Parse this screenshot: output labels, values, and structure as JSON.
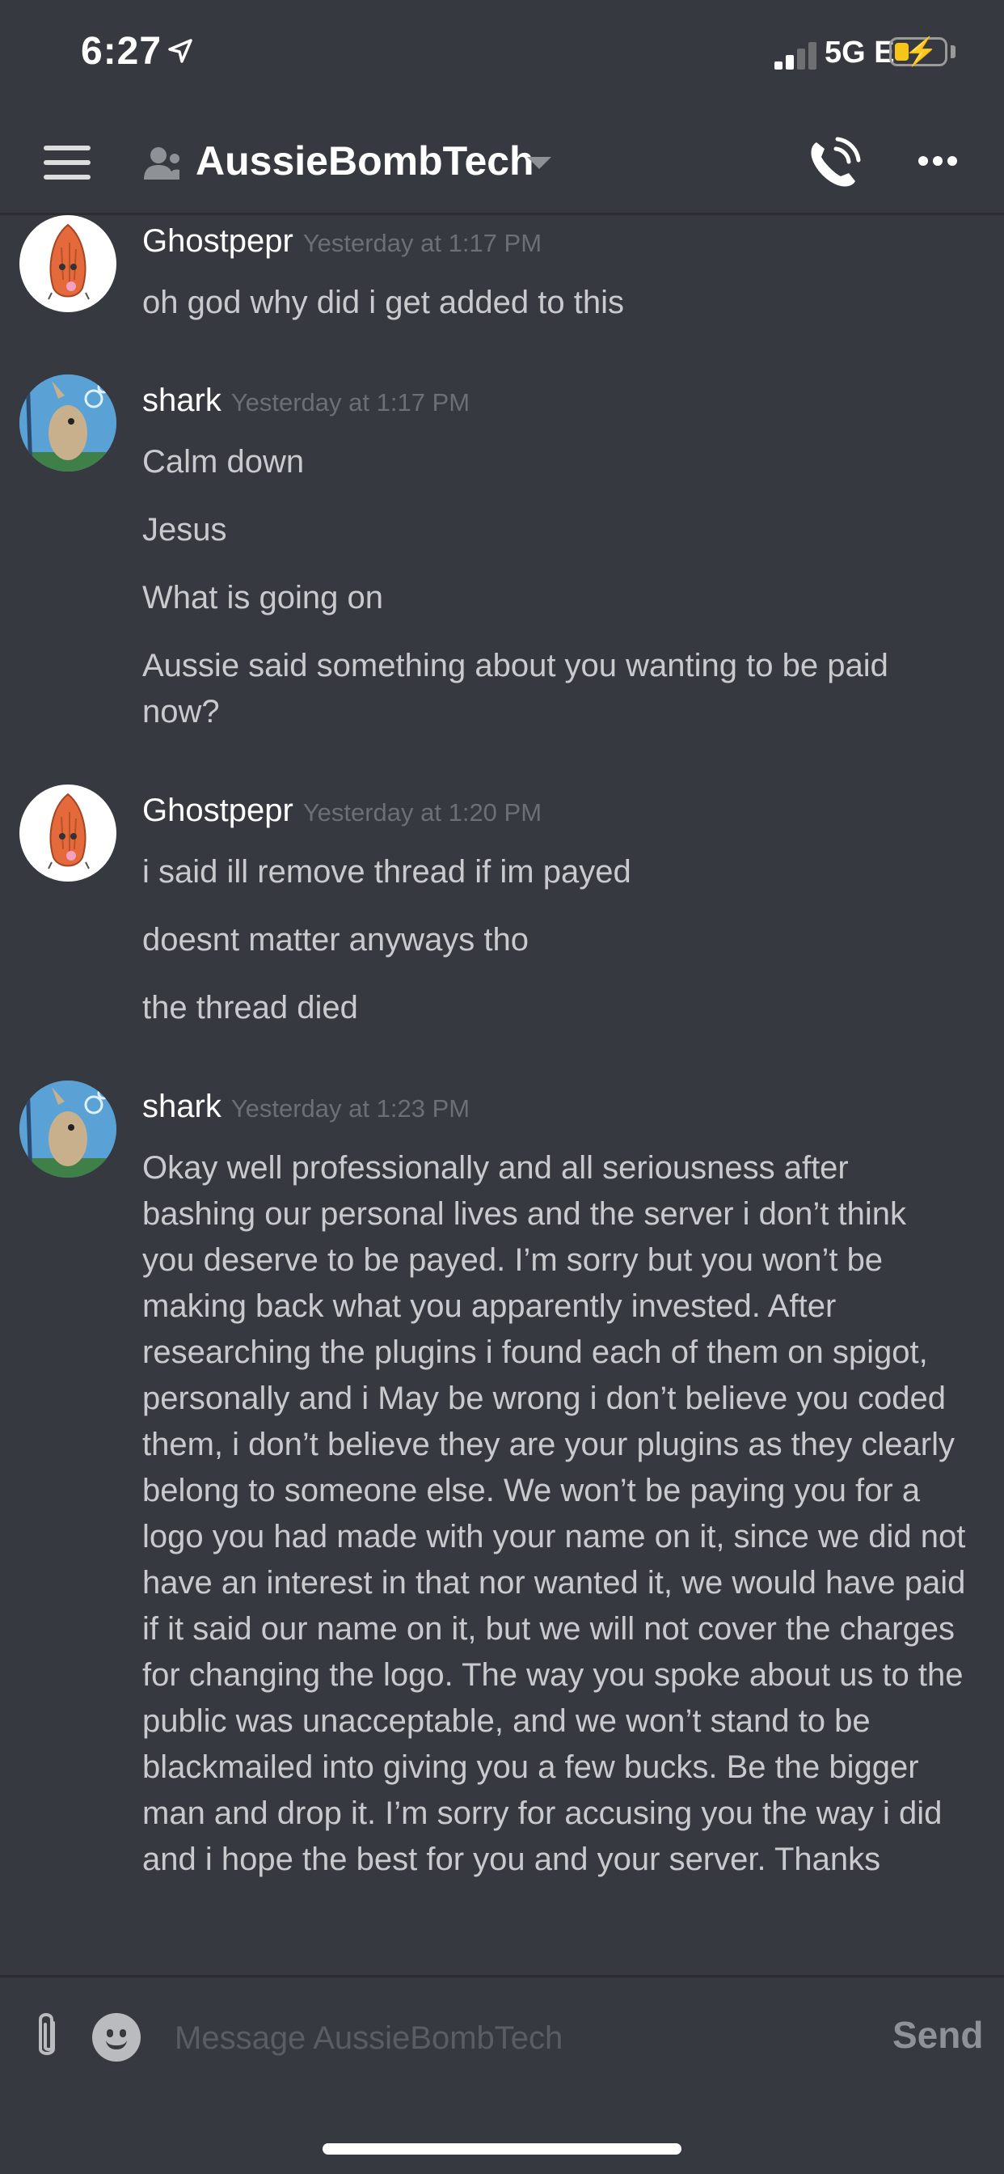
{
  "status_bar": {
    "time": "6:27",
    "network": "5G E",
    "battery_level": 0.3,
    "colors": {
      "battery": "#f5c518"
    }
  },
  "header": {
    "channel_title": "AussieBombTech",
    "icons": [
      "menu-icon",
      "user-icon",
      "chevron-down-icon",
      "call-icon",
      "more-icon"
    ]
  },
  "messages": [
    {
      "user": "Ghostpepr",
      "timestamp": "Yesterday at 1:17 PM",
      "avatar": "almond-avatar",
      "lines": [
        "oh god why did i get added to this"
      ]
    },
    {
      "user": "shark",
      "timestamp": "Yesterday at 1:17 PM",
      "avatar": "shark-avatar",
      "lines": [
        "Calm down",
        "Jesus",
        "What is going on",
        "Aussie said something about you wanting to be paid now?"
      ]
    },
    {
      "user": "Ghostpepr",
      "timestamp": "Yesterday at 1:20 PM",
      "avatar": "almond-avatar",
      "lines": [
        "i said ill remove thread if im payed",
        "doesnt matter anyways tho",
        "the thread died"
      ]
    },
    {
      "user": "shark",
      "timestamp": "Yesterday at 1:23 PM",
      "avatar": "shark-avatar",
      "lines": [
        "Okay well professionally and all seriousness after bashing our personal lives and the server i don’t think you deserve to be payed. I’m sorry but you won’t be making back what you apparently invested. After researching the plugins i found each of them on spigot, personally and i May be wrong i don’t believe you coded them, i don’t believe they are your plugins as they clearly belong to someone else. We won’t be paying you for a logo you had made with your name on it, since we did not have an interest in that nor wanted it, we would have paid if it said our name on it, but we will not cover the charges for changing the logo. The way you spoke about us to the public was unacceptable, and we won’t stand to be blackmailed into giving you a few bucks. Be the bigger man and drop it. I’m sorry for accusing you the way i did and i hope the best for you and your server. Thanks"
      ]
    }
  ],
  "composer": {
    "placeholder": "Message AussieBombTech",
    "value": "",
    "send_label": "Send",
    "icons": [
      "attach-icon",
      "emoji-icon"
    ]
  }
}
